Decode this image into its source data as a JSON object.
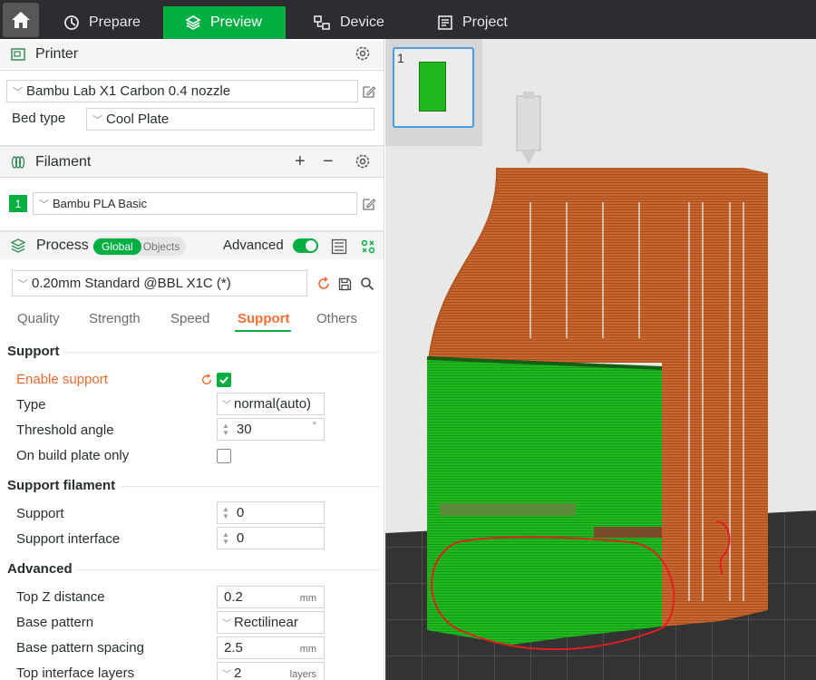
{
  "topbar": {
    "tabs": [
      {
        "label": "Prepare"
      },
      {
        "label": "Preview"
      },
      {
        "label": "Device"
      },
      {
        "label": "Project"
      }
    ],
    "accent_color": "#00ae42"
  },
  "printer": {
    "section_title": "Printer",
    "printer_name": "Bambu Lab X1 Carbon 0.4 nozzle",
    "bed_type_label": "Bed type",
    "bed_type_value": "Cool Plate"
  },
  "filament": {
    "section_title": "Filament",
    "slot_number": "1",
    "filament_name": "Bambu PLA Basic",
    "slot_color": "#00ae42"
  },
  "process": {
    "section_title": "Process",
    "toggle_global": "Global",
    "toggle_objects": "Objects",
    "advanced_label": "Advanced",
    "advanced_enabled": true,
    "preset_name": "0.20mm Standard @BBL X1C (*)",
    "tabs": [
      {
        "label": "Quality"
      },
      {
        "label": "Strength"
      },
      {
        "label": "Speed"
      },
      {
        "label": "Support"
      },
      {
        "label": "Others"
      }
    ],
    "active_tab": "Support"
  },
  "support": {
    "group_title": "Support",
    "enable_support_label": "Enable support",
    "enable_support_checked": true,
    "type_label": "Type",
    "type_value": "normal(auto)",
    "threshold_label": "Threshold angle",
    "threshold_value": "30",
    "threshold_unit": "°",
    "build_plate_label": "On build plate only",
    "build_plate_checked": false
  },
  "support_filament": {
    "group_title": "Support filament",
    "support_label": "Support",
    "support_value": "0",
    "interface_label": "Support interface",
    "interface_value": "0"
  },
  "advanced": {
    "group_title": "Advanced",
    "top_z_label": "Top Z distance",
    "top_z_value": "0.2",
    "top_z_unit": "mm",
    "base_pattern_label": "Base pattern",
    "base_pattern_value": "Rectilinear",
    "base_spacing_label": "Base pattern spacing",
    "base_spacing_value": "2.5",
    "base_spacing_unit": "mm",
    "top_interface_label": "Top interface layers",
    "top_interface_value": "2",
    "top_interface_unit": "layers"
  },
  "viewport": {
    "plate_number": "1",
    "model_color": "#c8662e",
    "support_color": "#1fb81f",
    "annotation_color": "#e02020"
  }
}
